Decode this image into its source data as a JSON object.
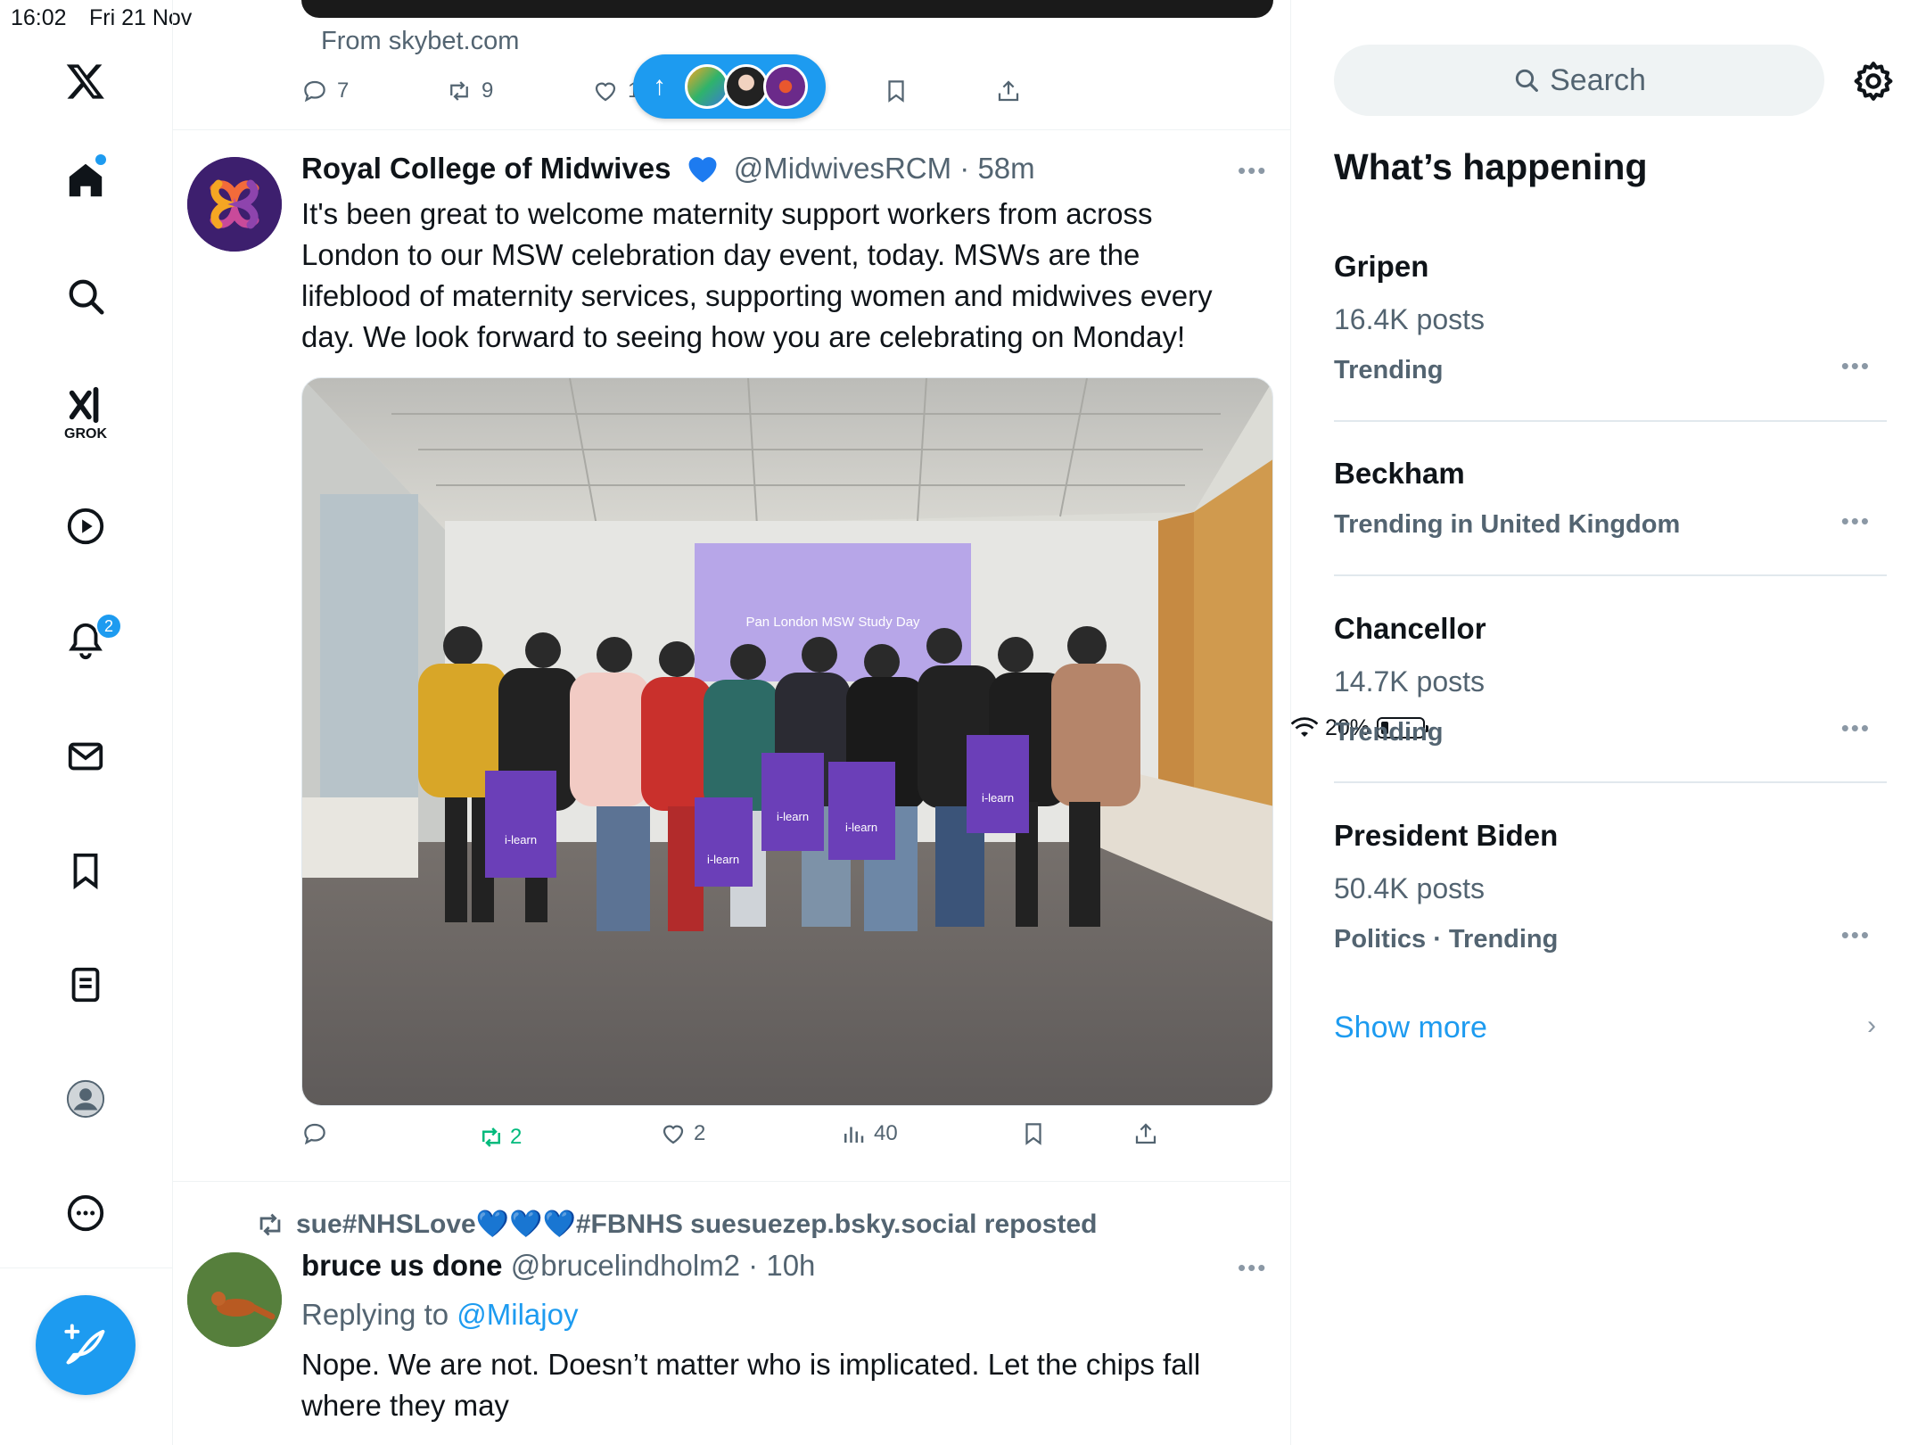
{
  "status_bar": {
    "time": "16:02",
    "date": "Fri 21 Nov",
    "battery": "20%"
  },
  "nav": {
    "grok_label": "GROK",
    "notifications_badge": "2"
  },
  "prev_tweet": {
    "from_link": "From skybet.com",
    "replies": "7",
    "reposts": "9",
    "likes": "1"
  },
  "tweet": {
    "name": "Royal College of Midwives",
    "handle": "@MidwivesRCM",
    "time": "58m",
    "text": "It's been great to welcome maternity support workers from across London to our MSW celebration day event, today. MSWs are the lifeblood of maternity services, supporting women and midwives every day. We look forward to seeing how you are celebrating on Monday!",
    "photo_caption": "Pan London MSW Study Day",
    "bag_label": "i-learn",
    "reposts": "2",
    "likes": "2",
    "views": "40"
  },
  "reply_tweet": {
    "repost_prefix": "sue#NHSLove",
    "repost_hearts": "💙💙💙",
    "repost_suffix": "#FBNHS suesuezep.bsky.social reposted",
    "name": "bruce us done",
    "handle": "@brucelindholm2",
    "time": "10h",
    "replying_prefix": "Replying to",
    "replying_to": "@Milajoy",
    "text": "Nope. We are not. Doesn’t matter who is implicated. Let the chips fall where they may"
  },
  "sidebar": {
    "search_placeholder": "Search",
    "title": "What’s happening",
    "trends": [
      {
        "name": "Gripen",
        "count": "16.4K posts",
        "meta": "Trending"
      },
      {
        "name": "Beckham",
        "count": "",
        "meta": "Trending in United Kingdom"
      },
      {
        "name": "Chancellor",
        "count": "14.7K posts",
        "meta": "Trending"
      },
      {
        "name": "President Biden",
        "count": "50.4K posts",
        "meta": "Politics · Trending"
      }
    ],
    "show_more": "Show more"
  },
  "colors": {
    "accent": "#1d9bf0",
    "repost_green": "#00ba7c",
    "text_secondary": "#536471"
  }
}
